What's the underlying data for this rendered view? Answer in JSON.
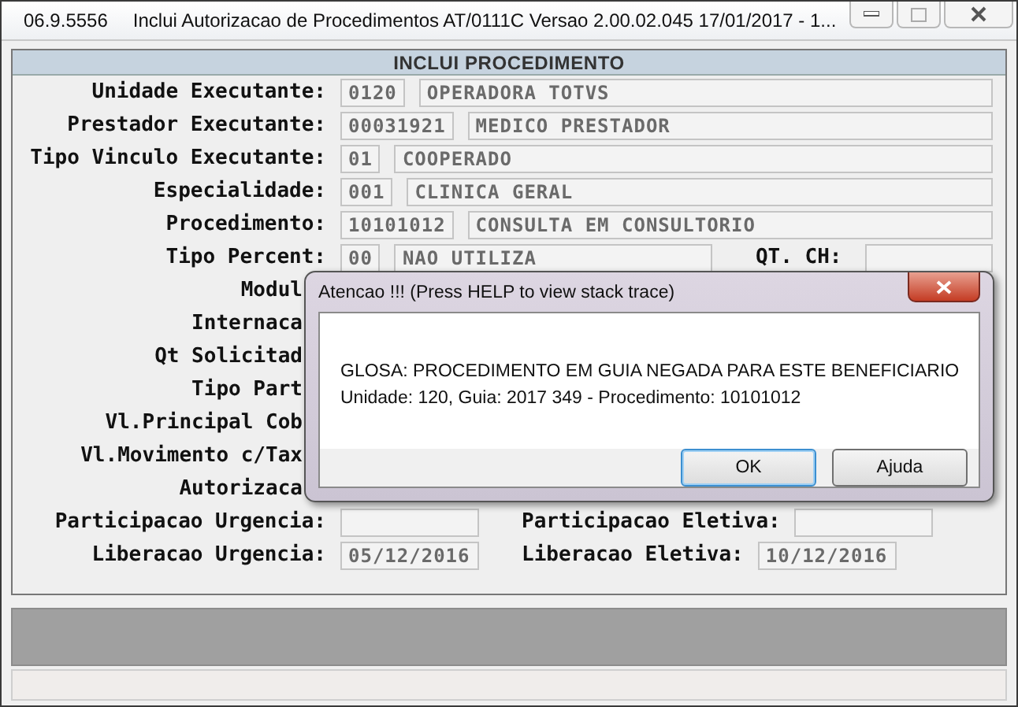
{
  "window": {
    "code": "06.9.5556",
    "title": "Inclui  Autorizacao de Procedimentos AT/0111C Versao 2.00.02.045 17/01/2017 - 1..."
  },
  "form": {
    "title": "INCLUI PROCEDIMENTO",
    "rows": [
      {
        "kind": "full",
        "items": [
          {
            "kind": "label",
            "text": "Unidade Executante:"
          },
          {
            "kind": "code",
            "text": "0120"
          },
          {
            "kind": "desc",
            "text": "OPERADORA TOTVS"
          }
        ]
      },
      {
        "kind": "full",
        "items": [
          {
            "kind": "label",
            "text": "Prestador Executante:"
          },
          {
            "kind": "code",
            "text": "00031921"
          },
          {
            "kind": "desc",
            "text": "MEDICO PRESTADOR"
          }
        ]
      },
      {
        "kind": "full",
        "items": [
          {
            "kind": "label",
            "text": "Tipo Vinculo Executante:"
          },
          {
            "kind": "code",
            "text": "01"
          },
          {
            "kind": "desc",
            "text": "COOPERADO"
          }
        ]
      },
      {
        "kind": "full",
        "items": [
          {
            "kind": "label",
            "text": "Especialidade:"
          },
          {
            "kind": "code",
            "text": "001"
          },
          {
            "kind": "desc",
            "text": "CLINICA GERAL"
          }
        ]
      },
      {
        "kind": "full",
        "items": [
          {
            "kind": "label",
            "text": "Procedimento:"
          },
          {
            "kind": "code",
            "text": "10101012"
          },
          {
            "kind": "desc",
            "text": "CONSULTA EM CONSULTORIO"
          }
        ]
      },
      {
        "kind": "full",
        "items": [
          {
            "kind": "label",
            "text": "Tipo Percent:"
          },
          {
            "kind": "code",
            "text": "00"
          },
          {
            "kind": "medium",
            "text": "NAO UTILIZA"
          },
          {
            "kind": "label",
            "text": "QT. CH:"
          },
          {
            "kind": "blank"
          }
        ]
      },
      {
        "kind": "covered",
        "items": [
          {
            "kind": "label",
            "text": "Modul"
          }
        ]
      },
      {
        "kind": "covered",
        "items": [
          {
            "kind": "label",
            "text": "Internaca"
          }
        ]
      },
      {
        "kind": "covered",
        "items": [
          {
            "kind": "label",
            "text": "Qt Solicitad"
          }
        ]
      },
      {
        "kind": "covered",
        "items": [
          {
            "kind": "label",
            "text": "Tipo Part"
          }
        ]
      },
      {
        "kind": "covered",
        "items": [
          {
            "kind": "label",
            "text": "Vl.Principal Cob"
          }
        ]
      },
      {
        "kind": "covered",
        "items": [
          {
            "kind": "label",
            "text": "Vl.Movimento c/Tax"
          }
        ]
      },
      {
        "kind": "covered",
        "items": [
          {
            "kind": "label",
            "text": "Autorizaca"
          }
        ]
      },
      {
        "kind": "full",
        "items": [
          {
            "kind": "label",
            "text": "Participacao Urgencia:"
          },
          {
            "kind": "date"
          },
          {
            "kind": "label",
            "text": "Participacao Eletiva:"
          },
          {
            "kind": "date"
          }
        ]
      },
      {
        "kind": "full",
        "items": [
          {
            "kind": "label",
            "text": "Liberacao Urgencia:"
          },
          {
            "kind": "date",
            "text": "05/12/2016"
          },
          {
            "kind": "label",
            "text": "Liberacao Eletiva:"
          },
          {
            "kind": "date",
            "text": "10/12/2016"
          }
        ]
      }
    ]
  },
  "dialog": {
    "title": "Atencao !!!  (Press HELP to view stack trace)",
    "message": [
      "GLOSA: PROCEDIMENTO EM GUIA NEGADA PARA ESTE BENEFICIARIO",
      "Unidade: 120, Guia: 2017 349 - Procedimento: 10101012"
    ],
    "buttons": [
      {
        "label": "OK",
        "selected": true
      },
      {
        "label": "Ajuda",
        "selected": false
      }
    ]
  }
}
